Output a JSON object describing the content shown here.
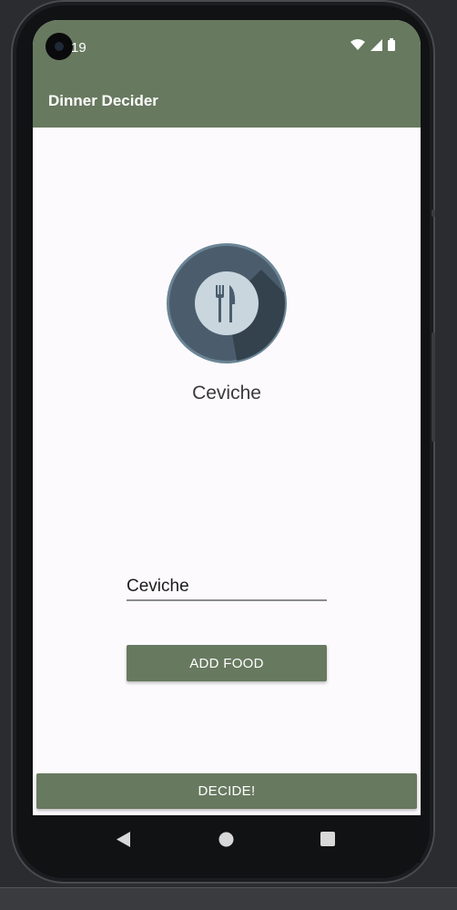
{
  "status_bar": {
    "time": "19",
    "icons": [
      "wifi-icon",
      "signal-icon",
      "battery-icon"
    ]
  },
  "app_bar": {
    "title": "Dinner Decider",
    "color": "#67795f"
  },
  "main": {
    "icon": "plate-fork-knife-icon",
    "selected_food": "Ceviche",
    "food_input": {
      "value": "Ceviche",
      "placeholder": ""
    },
    "add_button_label": "ADD FOOD",
    "decide_button_label": "DECIDE!"
  },
  "nav_bar": {
    "items": [
      "back-icon",
      "home-icon",
      "recents-icon"
    ]
  },
  "colors": {
    "accent": "#67795f",
    "background": "#fcfafd",
    "icon_outer": "#4b5d6d",
    "icon_inner": "#c9d6de"
  }
}
